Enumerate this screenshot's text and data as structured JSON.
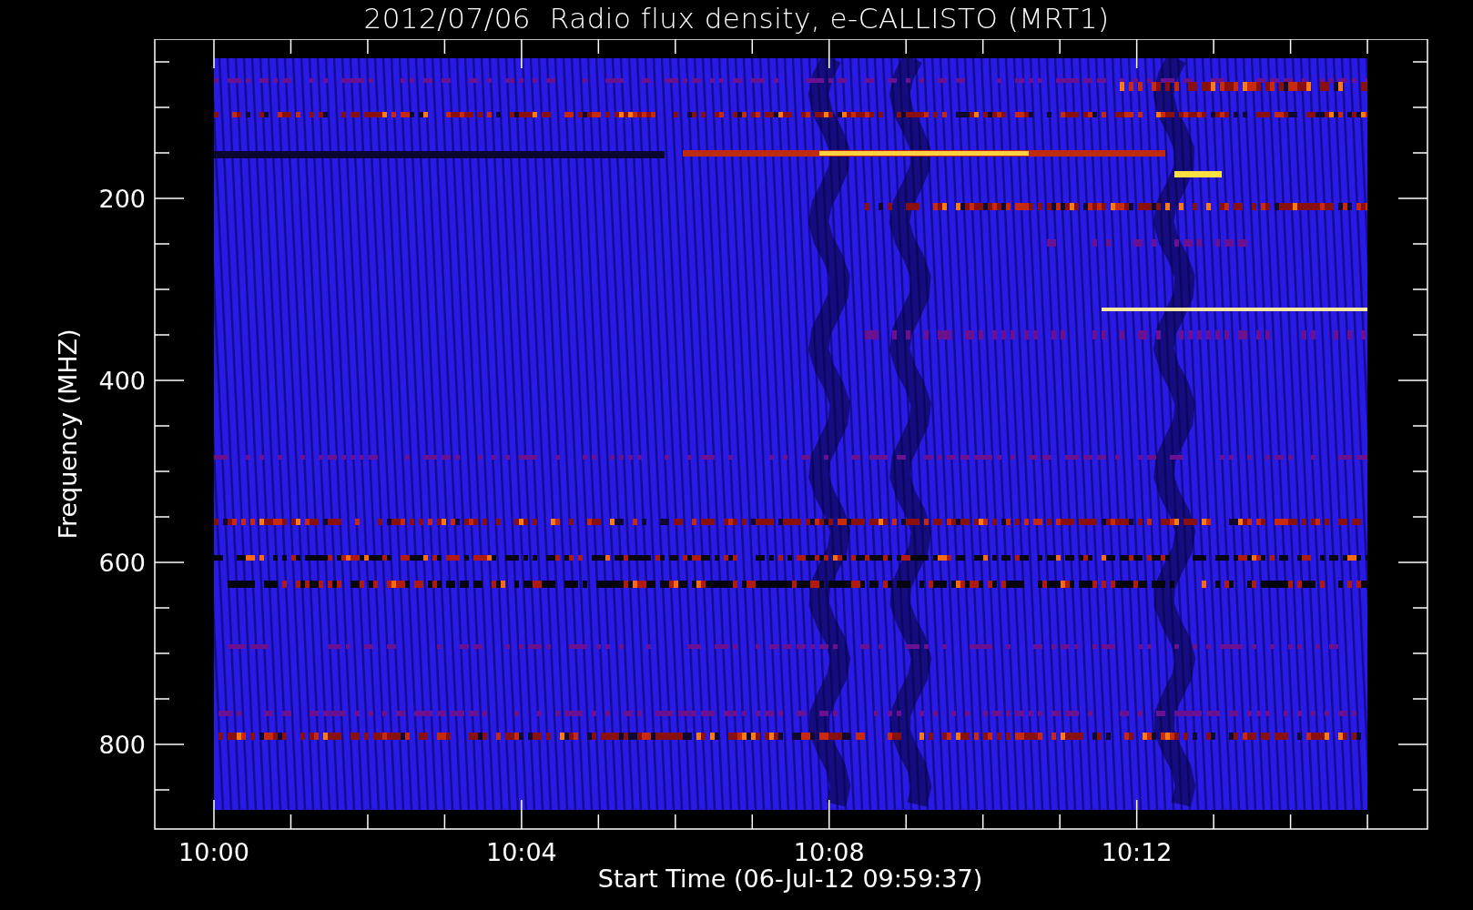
{
  "title": "2012/07/06  Radio flux density, e-CALLISTO (MRT1)",
  "plot": {
    "ylabel": "Frequency (MHZ)",
    "xlabel": "Start Time (06-Jul-12 09:59:37)",
    "yticks": [
      "200",
      "400",
      "600",
      "800"
    ],
    "xticks": [
      "10:00",
      "10:04",
      "10:08",
      "10:12"
    ]
  }
}
